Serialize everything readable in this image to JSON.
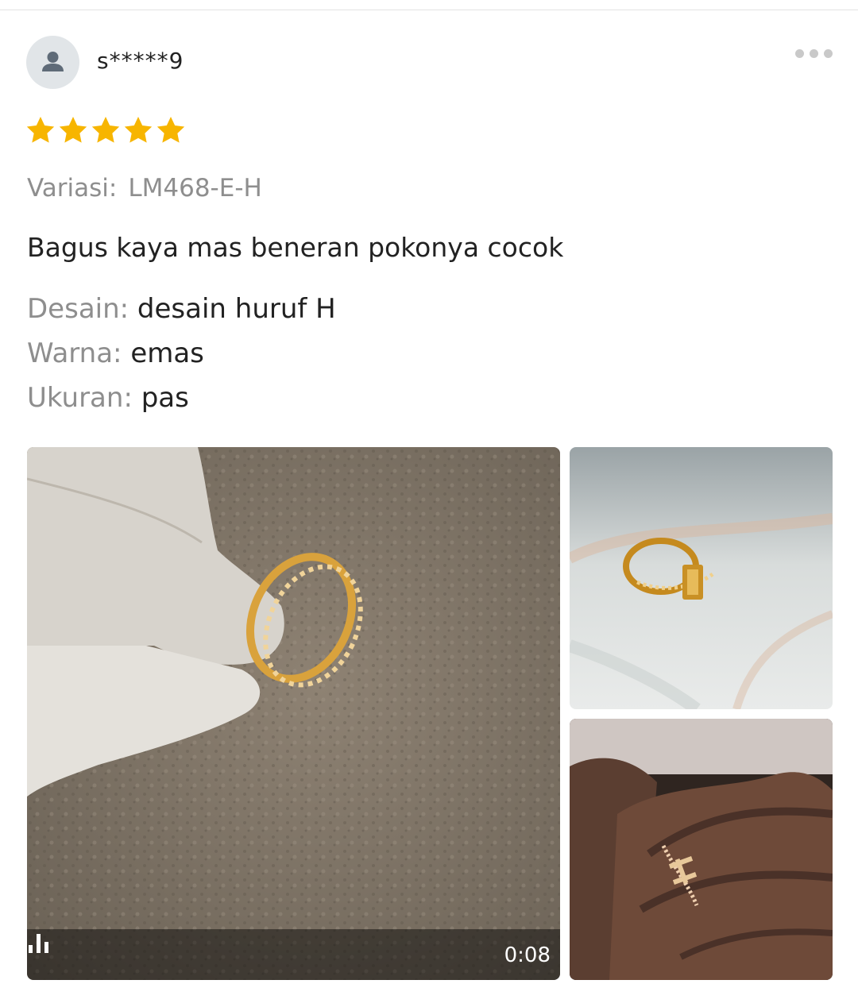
{
  "review": {
    "username": "s*****9",
    "rating": 5,
    "rating_max": 5,
    "star_color": "#f7b500",
    "variation_label": "Variasi:",
    "variation_value": "LM468-E-H",
    "comment": "Bagus kaya mas beneran pokonya cocok",
    "attributes": [
      {
        "key": "Desain:",
        "value": "desain huruf H"
      },
      {
        "key": "Warna:",
        "value": "emas"
      },
      {
        "key": "Ukuran:",
        "value": "pas"
      }
    ]
  },
  "media": {
    "video": {
      "duration": "0:08",
      "icon": "audio-bars-icon"
    },
    "photos": [
      "ring-on-table-photo",
      "ring-on-hand-photo"
    ]
  },
  "icons": {
    "avatar": "user-icon",
    "more": "more-dots-icon",
    "star": "star-icon"
  }
}
